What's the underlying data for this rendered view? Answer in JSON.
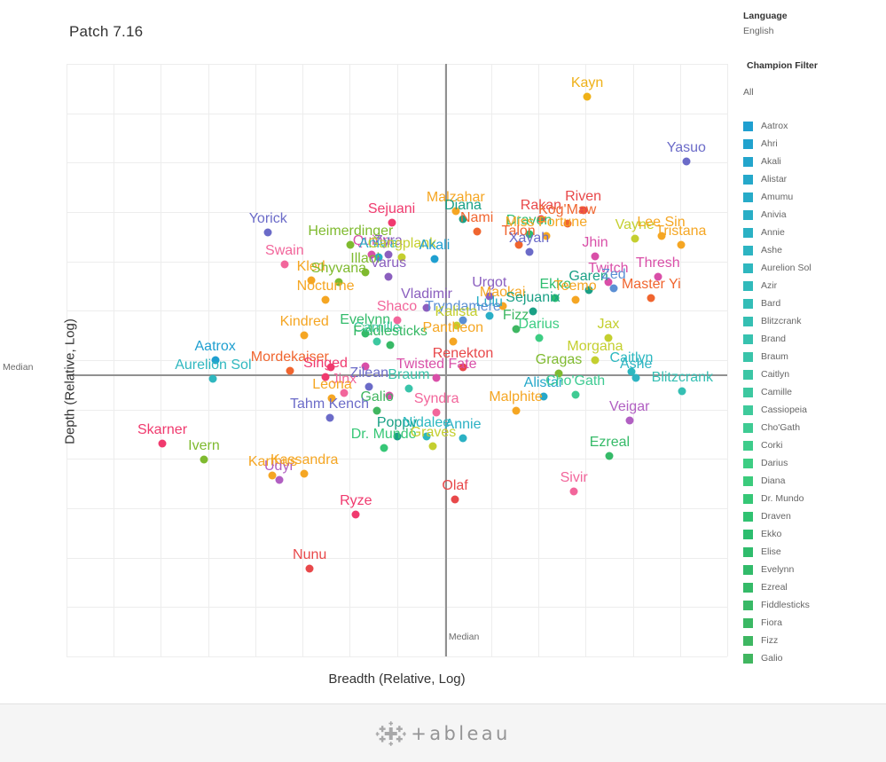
{
  "title": "Patch 7.16",
  "axes": {
    "x_label": "Breadth (Relative, Log)",
    "y_label": "Depth (Relative, Log)",
    "x_median_tag": "Median",
    "y_median_tag": "Median"
  },
  "sidebar": {
    "language_heading": "Language",
    "language_value": "English",
    "filter_heading": "Champion Filter",
    "filter_value": "All",
    "legend_items": [
      {
        "label": "Aatrox",
        "color": "#1f9fd0"
      },
      {
        "label": "Ahri",
        "color": "#21a2ce"
      },
      {
        "label": "Akali",
        "color": "#23a5cc"
      },
      {
        "label": "Alistar",
        "color": "#25a8ca"
      },
      {
        "label": "Amumu",
        "color": "#27abc8"
      },
      {
        "label": "Anivia",
        "color": "#29aec6"
      },
      {
        "label": "Annie",
        "color": "#2bb1c4"
      },
      {
        "label": "Ashe",
        "color": "#2db4c2"
      },
      {
        "label": "Aurelion Sol",
        "color": "#2fb7bf"
      },
      {
        "label": "Azir",
        "color": "#31babb"
      },
      {
        "label": "Bard",
        "color": "#33bdb7"
      },
      {
        "label": "Blitzcrank",
        "color": "#35bfb3"
      },
      {
        "label": "Brand",
        "color": "#37c2af"
      },
      {
        "label": "Braum",
        "color": "#39c4aa"
      },
      {
        "label": "Caitlyn",
        "color": "#3bc6a5"
      },
      {
        "label": "Camille",
        "color": "#3dc8a0"
      },
      {
        "label": "Cassiopeia",
        "color": "#3fca9b"
      },
      {
        "label": "Cho'Gath",
        "color": "#3fcb93"
      },
      {
        "label": "Corki",
        "color": "#3ecc8b"
      },
      {
        "label": "Darius",
        "color": "#3dcd83"
      },
      {
        "label": "Diana",
        "color": "#3bcb7c"
      },
      {
        "label": "Dr. Mundo",
        "color": "#36c776"
      },
      {
        "label": "Draven",
        "color": "#30c271"
      },
      {
        "label": "Ekko",
        "color": "#2cbd6e"
      },
      {
        "label": "Elise",
        "color": "#2fbc6c"
      },
      {
        "label": "Evelynn",
        "color": "#32bb6a"
      },
      {
        "label": "Ezreal",
        "color": "#35ba68"
      },
      {
        "label": "Fiddlesticks",
        "color": "#38b966"
      },
      {
        "label": "Fiora",
        "color": "#3bb864"
      },
      {
        "label": "Fizz",
        "color": "#3eb762"
      },
      {
        "label": "Galio",
        "color": "#41b660"
      }
    ]
  },
  "footer": {
    "brand": "+ableau"
  },
  "chart_data": {
    "type": "scatter",
    "title": "Patch 7.16",
    "xlabel": "Breadth (Relative, Log)",
    "ylabel": "Depth (Relative, Log)",
    "grid": true,
    "legend_position": "right",
    "x_median": 0.573,
    "y_median": 0.524,
    "note": "x,y are normalized 0..1 positions inside the plot area; y=0 is top of plot.",
    "points": [
      {
        "label": "Kayn",
        "x": 0.788,
        "y": 0.055,
        "color": "#efb118"
      },
      {
        "label": "Yasuo",
        "x": 0.938,
        "y": 0.165,
        "color": "#6b6bc8"
      },
      {
        "label": "Malzahar",
        "x": 0.589,
        "y": 0.248,
        "color": "#f5a623"
      },
      {
        "label": "Riven",
        "x": 0.782,
        "y": 0.247,
        "color": "#e8484a"
      },
      {
        "label": "Diana",
        "x": 0.6,
        "y": 0.262,
        "color": "#1aa085"
      },
      {
        "label": "Sejuani",
        "x": 0.492,
        "y": 0.268,
        "color": "#f03a6e"
      },
      {
        "label": "Rakan",
        "x": 0.718,
        "y": 0.262,
        "color": "#e8484a"
      },
      {
        "label": "Kog'Maw",
        "x": 0.758,
        "y": 0.27,
        "color": "#f0652f"
      },
      {
        "label": "Yorick",
        "x": 0.305,
        "y": 0.285,
        "color": "#6b6bc8"
      },
      {
        "label": "Nami",
        "x": 0.621,
        "y": 0.283,
        "color": "#f0652f"
      },
      {
        "label": "Draven",
        "x": 0.7,
        "y": 0.287,
        "color": "#2cbd6e"
      },
      {
        "label": "Miss Fortune",
        "x": 0.726,
        "y": 0.29,
        "color": "#f5a623"
      },
      {
        "label": "Vayne",
        "x": 0.86,
        "y": 0.295,
        "color": "#c4cf2f"
      },
      {
        "label": "Lee Sin",
        "x": 0.9,
        "y": 0.29,
        "color": "#f5a623"
      },
      {
        "label": "Tristana",
        "x": 0.93,
        "y": 0.305,
        "color": "#f5a623"
      },
      {
        "label": "Heimerdinger",
        "x": 0.43,
        "y": 0.305,
        "color": "#7fba2f"
      },
      {
        "label": "Talon",
        "x": 0.684,
        "y": 0.305,
        "color": "#f0652f"
      },
      {
        "label": "Xayah",
        "x": 0.7,
        "y": 0.318,
        "color": "#6b6bc8"
      },
      {
        "label": "Jhin",
        "x": 0.8,
        "y": 0.325,
        "color": "#d94fa8"
      },
      {
        "label": "Swain",
        "x": 0.33,
        "y": 0.338,
        "color": "#f2669b"
      },
      {
        "label": "Quinn",
        "x": 0.462,
        "y": 0.322,
        "color": "#d94fa8"
      },
      {
        "label": "Zyra",
        "x": 0.487,
        "y": 0.322,
        "color": "#8b5fbf"
      },
      {
        "label": "Anivia",
        "x": 0.472,
        "y": 0.327,
        "color": "#29aec6"
      },
      {
        "label": "Gangplank",
        "x": 0.508,
        "y": 0.327,
        "color": "#c4cf2f"
      },
      {
        "label": "Akali",
        "x": 0.557,
        "y": 0.33,
        "color": "#1f9fd0"
      },
      {
        "label": "Illaoi",
        "x": 0.452,
        "y": 0.352,
        "color": "#7fba2f"
      },
      {
        "label": "Kled",
        "x": 0.37,
        "y": 0.365,
        "color": "#f5a623"
      },
      {
        "label": "Shyvana",
        "x": 0.412,
        "y": 0.368,
        "color": "#7fba2f"
      },
      {
        "label": "Varus",
        "x": 0.487,
        "y": 0.36,
        "color": "#8b5fbf"
      },
      {
        "label": "Twitch",
        "x": 0.82,
        "y": 0.368,
        "color": "#d94fa8"
      },
      {
        "label": "Thresh",
        "x": 0.895,
        "y": 0.36,
        "color": "#d94fa8"
      },
      {
        "label": "Garen",
        "x": 0.79,
        "y": 0.382,
        "color": "#1aa085"
      },
      {
        "label": "Zed",
        "x": 0.828,
        "y": 0.378,
        "color": "#5b8fd4"
      },
      {
        "label": "Nocturne",
        "x": 0.392,
        "y": 0.398,
        "color": "#f5a623"
      },
      {
        "label": "Urgot",
        "x": 0.64,
        "y": 0.392,
        "color": "#8b5fbf"
      },
      {
        "label": "Ekko",
        "x": 0.74,
        "y": 0.395,
        "color": "#2cbd6e"
      },
      {
        "label": "Teemo",
        "x": 0.77,
        "y": 0.398,
        "color": "#f5a623"
      },
      {
        "label": "Master Yi",
        "x": 0.885,
        "y": 0.395,
        "color": "#f0652f"
      },
      {
        "label": "Vladimir",
        "x": 0.545,
        "y": 0.412,
        "color": "#8b5fbf"
      },
      {
        "label": "Maokai",
        "x": 0.66,
        "y": 0.408,
        "color": "#f5a623"
      },
      {
        "label": "Sejuanix",
        "x": 0.706,
        "y": 0.418,
        "color": "#1aa085"
      },
      {
        "label": "Lulu",
        "x": 0.64,
        "y": 0.425,
        "color": "#29aec6"
      },
      {
        "label": "Shaco",
        "x": 0.5,
        "y": 0.432,
        "color": "#f2669b"
      },
      {
        "label": "Tryndamere",
        "x": 0.6,
        "y": 0.432,
        "color": "#5b8fd4"
      },
      {
        "label": "Kalista",
        "x": 0.59,
        "y": 0.442,
        "color": "#c4cf2f"
      },
      {
        "label": "Fizz",
        "x": 0.68,
        "y": 0.448,
        "color": "#3eb762"
      },
      {
        "label": "Jax",
        "x": 0.82,
        "y": 0.462,
        "color": "#c4cf2f"
      },
      {
        "label": "Kindred",
        "x": 0.36,
        "y": 0.458,
        "color": "#f5a623"
      },
      {
        "label": "Evelynn",
        "x": 0.452,
        "y": 0.455,
        "color": "#32bb6a"
      },
      {
        "label": "Camille",
        "x": 0.47,
        "y": 0.468,
        "color": "#3dc8a0"
      },
      {
        "label": "Fiddlesticks",
        "x": 0.49,
        "y": 0.475,
        "color": "#38b966"
      },
      {
        "label": "Pantheon",
        "x": 0.585,
        "y": 0.468,
        "color": "#f5a623"
      },
      {
        "label": "Darius",
        "x": 0.715,
        "y": 0.462,
        "color": "#3dcd83"
      },
      {
        "label": "Aatrox",
        "x": 0.225,
        "y": 0.5,
        "color": "#1f9fd0"
      },
      {
        "label": "Mordekaiser",
        "x": 0.338,
        "y": 0.518,
        "color": "#f0652f"
      },
      {
        "label": "Rakan2",
        "x": 0.4,
        "y": 0.512,
        "color": "#f03a6e"
      },
      {
        "label": "Kalista2",
        "x": 0.452,
        "y": 0.51,
        "color": "#d94fa8"
      },
      {
        "label": "Renekton",
        "x": 0.6,
        "y": 0.512,
        "color": "#e8484a"
      },
      {
        "label": "Morgana",
        "x": 0.8,
        "y": 0.5,
        "color": "#c4cf2f"
      },
      {
        "label": "Aurelion Sol",
        "x": 0.222,
        "y": 0.532,
        "color": "#2fb7bf"
      },
      {
        "label": "Singed",
        "x": 0.392,
        "y": 0.528,
        "color": "#f03a6e"
      },
      {
        "label": "Twisted Fate",
        "x": 0.56,
        "y": 0.53,
        "color": "#d94fa8"
      },
      {
        "label": "Gragas",
        "x": 0.745,
        "y": 0.522,
        "color": "#7fba2f"
      },
      {
        "label": "Caitlyn",
        "x": 0.855,
        "y": 0.52,
        "color": "#2cb8c0"
      },
      {
        "label": "Zilean",
        "x": 0.458,
        "y": 0.545,
        "color": "#6b6bc8"
      },
      {
        "label": "Ashe",
        "x": 0.862,
        "y": 0.53,
        "color": "#2db4c2"
      },
      {
        "label": "Jinx",
        "x": 0.42,
        "y": 0.555,
        "color": "#f2669b"
      },
      {
        "label": "Braum",
        "x": 0.518,
        "y": 0.548,
        "color": "#39c4aa"
      },
      {
        "label": "Leona",
        "x": 0.402,
        "y": 0.565,
        "color": "#f5a623"
      },
      {
        "label": "Nidalee2",
        "x": 0.488,
        "y": 0.56,
        "color": "#d94fa8"
      },
      {
        "label": "Alistar",
        "x": 0.722,
        "y": 0.562,
        "color": "#25a8ca"
      },
      {
        "label": "Cho'Gath",
        "x": 0.77,
        "y": 0.558,
        "color": "#3fcb93"
      },
      {
        "label": "Blitzcrank",
        "x": 0.932,
        "y": 0.552,
        "color": "#35bfb3"
      },
      {
        "label": "Galio",
        "x": 0.47,
        "y": 0.585,
        "color": "#41b660"
      },
      {
        "label": "Syndra",
        "x": 0.56,
        "y": 0.588,
        "color": "#f2669b"
      },
      {
        "label": "Malphite",
        "x": 0.68,
        "y": 0.585,
        "color": "#f5a623"
      },
      {
        "label": "Tahm Kench",
        "x": 0.398,
        "y": 0.598,
        "color": "#6b6bc8"
      },
      {
        "label": "Veigar",
        "x": 0.852,
        "y": 0.602,
        "color": "#b15fc2"
      },
      {
        "label": "Skarner",
        "x": 0.145,
        "y": 0.64,
        "color": "#f03a6e"
      },
      {
        "label": "Poppy",
        "x": 0.5,
        "y": 0.628,
        "color": "#1aa085"
      },
      {
        "label": "Nidalee",
        "x": 0.545,
        "y": 0.628,
        "color": "#2cb8c0"
      },
      {
        "label": "Annie",
        "x": 0.6,
        "y": 0.632,
        "color": "#2bb1c4"
      },
      {
        "label": "Ivern",
        "x": 0.208,
        "y": 0.668,
        "color": "#7fba2f"
      },
      {
        "label": "Dr. Mundo",
        "x": 0.48,
        "y": 0.648,
        "color": "#36c776"
      },
      {
        "label": "Graves",
        "x": 0.555,
        "y": 0.645,
        "color": "#c4cf2f"
      },
      {
        "label": "Ezreal",
        "x": 0.822,
        "y": 0.662,
        "color": "#35ba68"
      },
      {
        "label": "Karthus",
        "x": 0.312,
        "y": 0.695,
        "color": "#f5a623"
      },
      {
        "label": "Udyr",
        "x": 0.322,
        "y": 0.702,
        "color": "#b15fc2"
      },
      {
        "label": "Kassandra",
        "x": 0.36,
        "y": 0.692,
        "color": "#f5a623"
      },
      {
        "label": "Sivir",
        "x": 0.768,
        "y": 0.722,
        "color": "#f2669b"
      },
      {
        "label": "Olaf",
        "x": 0.588,
        "y": 0.735,
        "color": "#e8484a"
      },
      {
        "label": "Ryze",
        "x": 0.438,
        "y": 0.76,
        "color": "#f03a6e"
      },
      {
        "label": "Nunu",
        "x": 0.368,
        "y": 0.852,
        "color": "#e8484a"
      }
    ]
  }
}
